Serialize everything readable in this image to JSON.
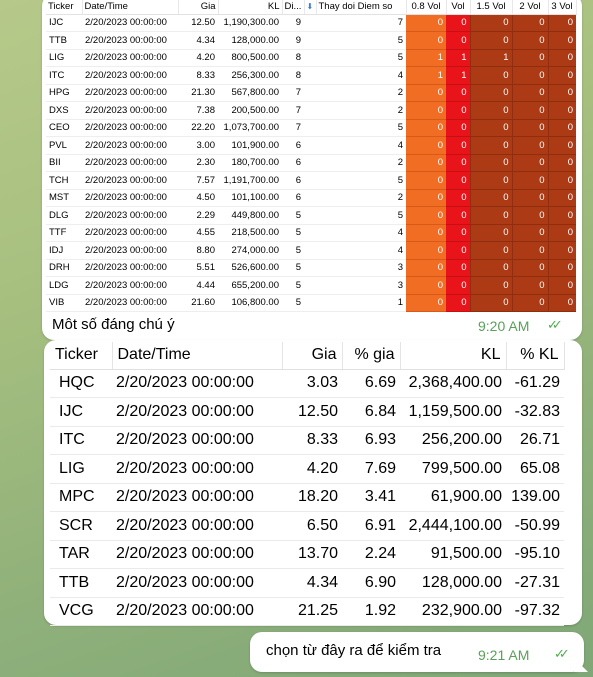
{
  "colors": {
    "vol08": "#f26d24",
    "vol": "#e8141a",
    "vol_dark": "#ac3a14",
    "time_green": "#5aa05a"
  },
  "msg1": {
    "headers": [
      "Ticker",
      "Date/Time",
      "Gia",
      "KL",
      "Di...",
      "",
      "Thay doi Diem so",
      "0.8 Vol",
      "Vol",
      "1.5 Vol",
      "2 Vol",
      "3 Vol"
    ],
    "rows": [
      [
        "IJC",
        "2/20/2023 00:00:00",
        "12.50",
        "1,190,300.00",
        "9",
        "",
        "7",
        "0",
        "0",
        "0",
        "0",
        "0"
      ],
      [
        "TTB",
        "2/20/2023 00:00:00",
        "4.34",
        "128,000.00",
        "9",
        "",
        "5",
        "0",
        "0",
        "0",
        "0",
        "0"
      ],
      [
        "LIG",
        "2/20/2023 00:00:00",
        "4.20",
        "800,500.00",
        "8",
        "",
        "5",
        "1",
        "1",
        "1",
        "0",
        "0"
      ],
      [
        "ITC",
        "2/20/2023 00:00:00",
        "8.33",
        "256,300.00",
        "8",
        "",
        "4",
        "1",
        "1",
        "0",
        "0",
        "0"
      ],
      [
        "HPG",
        "2/20/2023 00:00:00",
        "21.30",
        "567,800.00",
        "7",
        "",
        "2",
        "0",
        "0",
        "0",
        "0",
        "0"
      ],
      [
        "DXS",
        "2/20/2023 00:00:00",
        "7.38",
        "200,500.00",
        "7",
        "",
        "2",
        "0",
        "0",
        "0",
        "0",
        "0"
      ],
      [
        "CEO",
        "2/20/2023 00:00:00",
        "22.20",
        "1,073,700.00",
        "7",
        "",
        "5",
        "0",
        "0",
        "0",
        "0",
        "0"
      ],
      [
        "PVL",
        "2/20/2023 00:00:00",
        "3.00",
        "101,900.00",
        "6",
        "",
        "4",
        "0",
        "0",
        "0",
        "0",
        "0"
      ],
      [
        "BII",
        "2/20/2023 00:00:00",
        "2.30",
        "180,700.00",
        "6",
        "",
        "2",
        "0",
        "0",
        "0",
        "0",
        "0"
      ],
      [
        "TCH",
        "2/20/2023 00:00:00",
        "7.57",
        "1,191,700.00",
        "6",
        "",
        "5",
        "0",
        "0",
        "0",
        "0",
        "0"
      ],
      [
        "MST",
        "2/20/2023 00:00:00",
        "4.50",
        "101,100.00",
        "6",
        "",
        "2",
        "0",
        "0",
        "0",
        "0",
        "0"
      ],
      [
        "DLG",
        "2/20/2023 00:00:00",
        "2.29",
        "449,800.00",
        "5",
        "",
        "5",
        "0",
        "0",
        "0",
        "0",
        "0"
      ],
      [
        "TTF",
        "2/20/2023 00:00:00",
        "4.55",
        "218,500.00",
        "5",
        "",
        "4",
        "0",
        "0",
        "0",
        "0",
        "0"
      ],
      [
        "IDJ",
        "2/20/2023 00:00:00",
        "8.80",
        "274,000.00",
        "5",
        "",
        "4",
        "0",
        "0",
        "0",
        "0",
        "0"
      ],
      [
        "DRH",
        "2/20/2023 00:00:00",
        "5.51",
        "526,600.00",
        "5",
        "",
        "3",
        "0",
        "0",
        "0",
        "0",
        "0"
      ],
      [
        "LDG",
        "2/20/2023 00:00:00",
        "4.44",
        "655,200.00",
        "5",
        "",
        "3",
        "0",
        "0",
        "0",
        "0",
        "0"
      ],
      [
        "VIB",
        "2/20/2023 00:00:00",
        "21.60",
        "106,800.00",
        "5",
        "",
        "1",
        "0",
        "0",
        "0",
        "0",
        "0"
      ]
    ],
    "caption": "Môt số đáng chú ý",
    "time": "9:20 AM",
    "ticks": "✓✓"
  },
  "msg2": {
    "headers": [
      "Ticker",
      "Date/Time",
      "Gia",
      "% gia",
      "KL",
      "% KL"
    ],
    "rows": [
      [
        "HQC",
        "2/20/2023 00:00:00",
        "3.03",
        "6.69",
        "2,368,400.00",
        "-61.29"
      ],
      [
        "IJC",
        "2/20/2023 00:00:00",
        "12.50",
        "6.84",
        "1,159,500.00",
        "-32.83"
      ],
      [
        "ITC",
        "2/20/2023 00:00:00",
        "8.33",
        "6.93",
        "256,200.00",
        "26.71"
      ],
      [
        "LIG",
        "2/20/2023 00:00:00",
        "4.20",
        "7.69",
        "799,500.00",
        "65.08"
      ],
      [
        "MPC",
        "2/20/2023 00:00:00",
        "18.20",
        "3.41",
        "61,900.00",
        "139.00"
      ],
      [
        "SCR",
        "2/20/2023 00:00:00",
        "6.50",
        "6.91",
        "2,444,100.00",
        "-50.99"
      ],
      [
        "TAR",
        "2/20/2023 00:00:00",
        "13.70",
        "2.24",
        "91,500.00",
        "-95.10"
      ],
      [
        "TTB",
        "2/20/2023 00:00:00",
        "4.34",
        "6.90",
        "128,000.00",
        "-27.31"
      ],
      [
        "VCG",
        "2/20/2023 00:00:00",
        "21.25",
        "1.92",
        "232,900.00",
        "-97.32"
      ]
    ]
  },
  "msg3": {
    "text": "chọn từ đây ra để kiểm tra",
    "time": "9:21 AM",
    "ticks": "✓✓"
  }
}
